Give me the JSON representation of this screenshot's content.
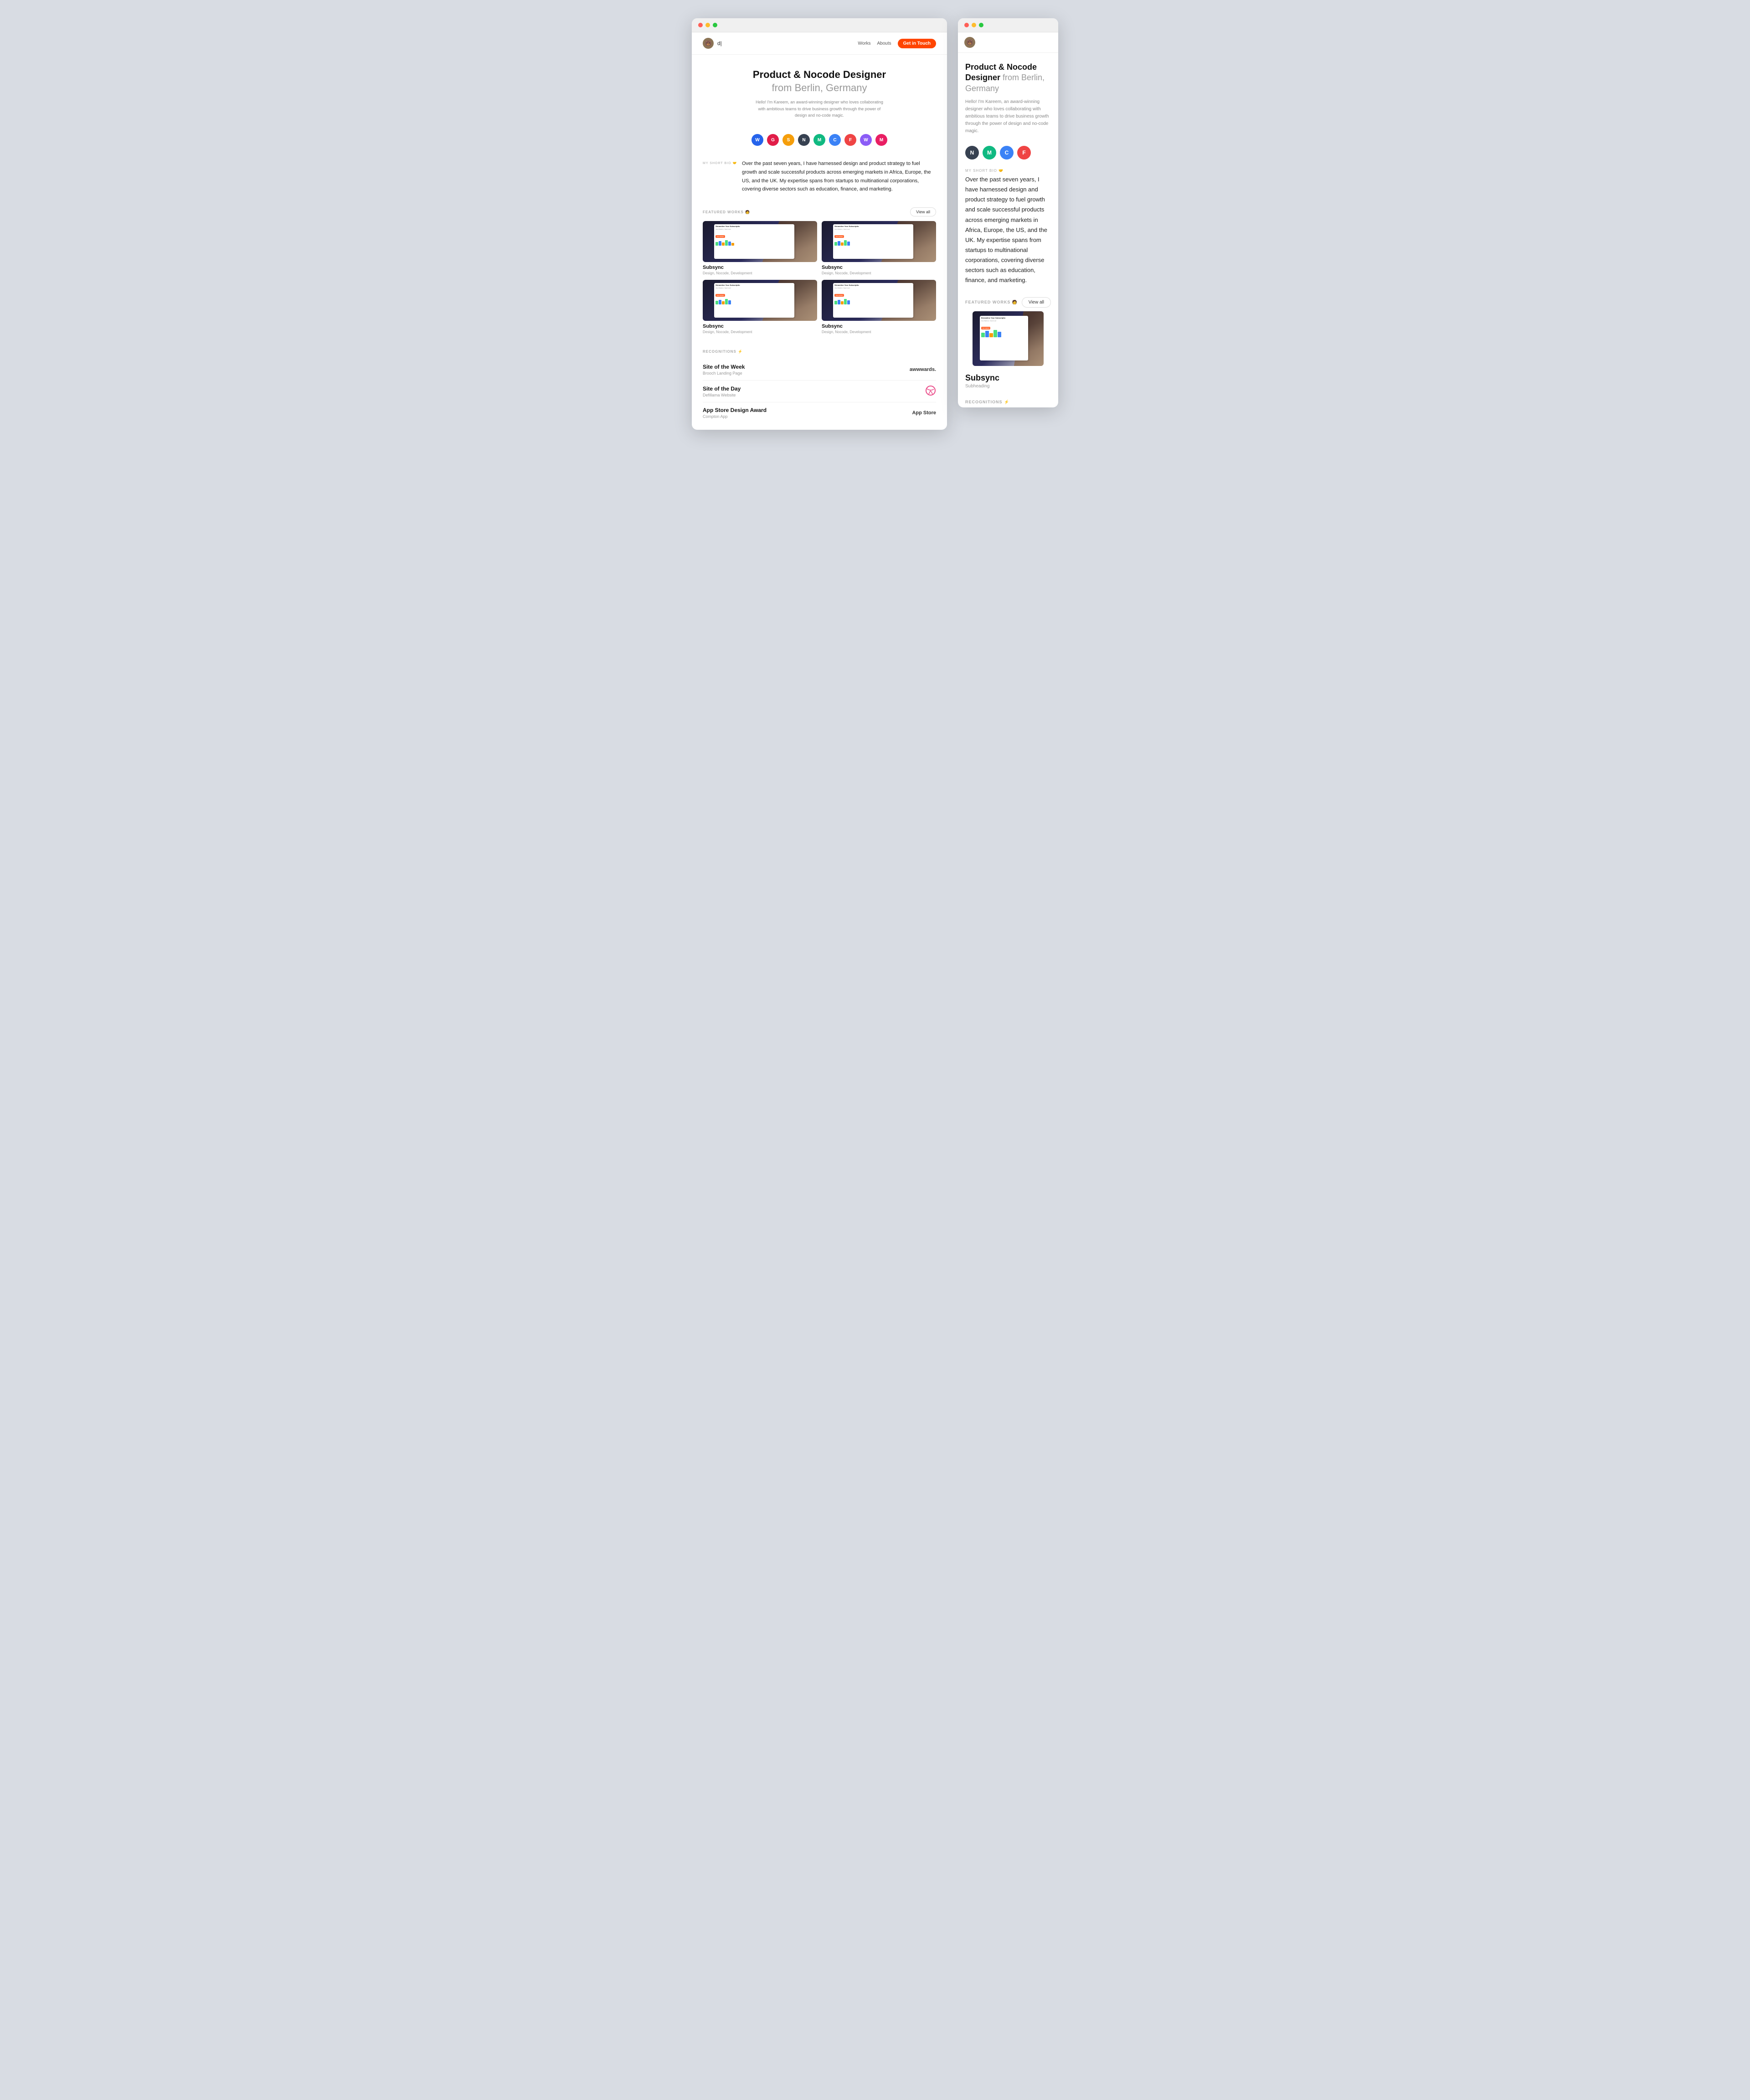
{
  "colors": {
    "red": "#ff5f57",
    "yellow": "#febc2e",
    "green": "#28c840",
    "cta": "#ff4500",
    "accent": "#ff6b35"
  },
  "leftWindow": {
    "nav": {
      "logo": "d|",
      "links": [
        "Works",
        "Abouts"
      ],
      "cta": "Get in Touch"
    },
    "hero": {
      "title": "Product & Nocode Designer",
      "subtitle": "from Berlin, Germany",
      "description": "Hello! I'm Kareem, an award-winning designer who loves collaborating with ambitious teams to drive business growth through the power of design and no-code magic."
    },
    "tools": [
      {
        "color": "#2563eb",
        "label": "W"
      },
      {
        "color": "#e11d48",
        "label": "G"
      },
      {
        "color": "#f59e0b",
        "label": "S"
      },
      {
        "color": "#374151",
        "label": "N"
      },
      {
        "color": "#10b981",
        "label": "M"
      },
      {
        "color": "#3b82f6",
        "label": "C"
      },
      {
        "color": "#ef4444",
        "label": "F"
      },
      {
        "color": "#8b5cf6",
        "label": "W"
      },
      {
        "color": "#e91e63",
        "label": "M"
      }
    ],
    "bio": {
      "label": "MY SHORT BIO 🤝",
      "text": "Over the past seven years, I have harnessed design and product strategy to fuel growth and scale successful products across emerging markets in Africa, Europe, the US, and the UK. My expertise spans from startups to multinational corporations, covering diverse sectors such as education, finance, and marketing."
    },
    "featuredWorks": {
      "label": "FEATURED WORKS 🧑",
      "viewAll": "View all",
      "items": [
        {
          "name": "Subsync",
          "tags": "Design, Nocode, Development"
        },
        {
          "name": "Subsync",
          "tags": "Design, Nocode, Development"
        },
        {
          "name": "Subsync",
          "tags": "Design, Nocode, Development"
        },
        {
          "name": "Subsync",
          "tags": "Design, Nocode, Development"
        }
      ],
      "thumbContent": {
        "title": "Streamline Your Subscriptio",
        "sub": "One Platform, Total Contr"
      }
    },
    "recognitions": {
      "label": "RECOGNITIONS ⚡",
      "items": [
        {
          "title": "Site of the Week",
          "subtitle": "Brooch Landing Page",
          "logo": "awwwards."
        },
        {
          "title": "Site of the Day",
          "subtitle": "Defillama Website",
          "logo": "dribbble"
        },
        {
          "title": "App Store Design Award",
          "subtitle": "Compton App",
          "logo": "App Store"
        }
      ]
    }
  },
  "rightWindow": {
    "hero": {
      "title": "Product & Nocode Designer",
      "subtitle": "from Berlin, Germany",
      "description": "Hello! I'm Kareem, an award-winning designer who loves collaborating with ambitious teams to drive business growth through the power of design and no-code magic."
    },
    "tools": [
      {
        "color": "#374151",
        "label": "N"
      },
      {
        "color": "#10b981",
        "label": "M"
      },
      {
        "color": "#3b82f6",
        "label": "C"
      },
      {
        "color": "#ef4444",
        "label": "F"
      }
    ],
    "bio": {
      "label": "MY SHORT BIO 🤝",
      "text": "Over the past seven years, I have harnessed design and product strategy to fuel growth and scale successful products across emerging markets in Africa, Europe, the US, and the UK. My expertise spans from startups to multinational corporations, covering diverse sectors such as education, finance, and marketing."
    },
    "featuredWorks": {
      "label": "FEATURED WORKS 🧑",
      "viewAll": "View all",
      "item": {
        "name": "Subsync",
        "subheading": "Subheading"
      }
    },
    "recognitions": {
      "label": "RECOGNITIONS ⚡"
    }
  }
}
